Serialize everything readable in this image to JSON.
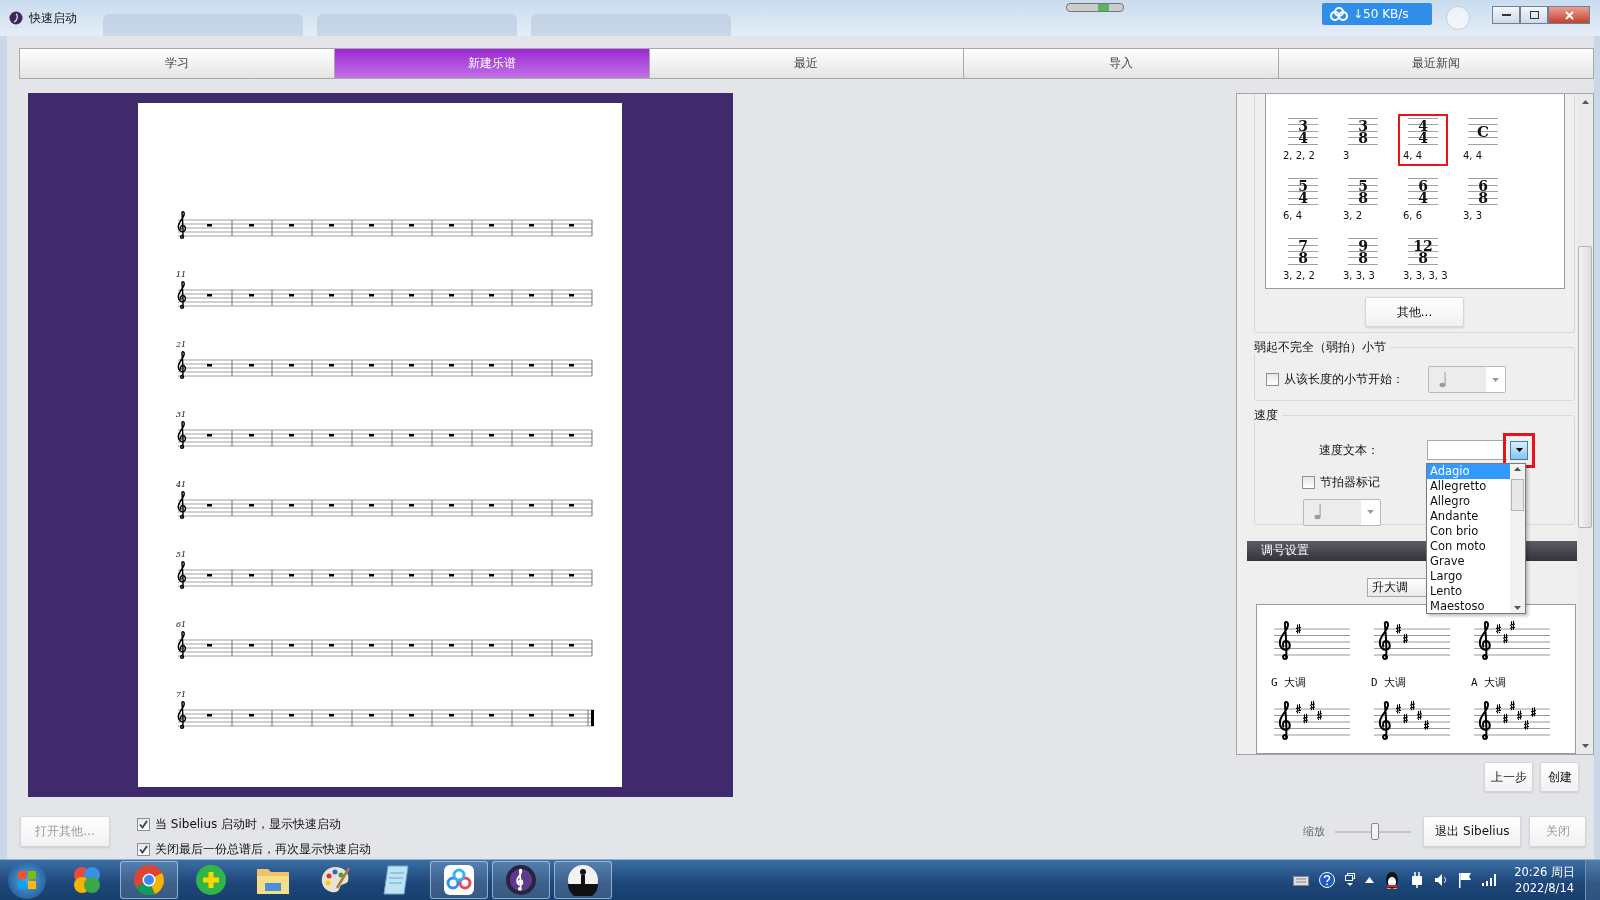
{
  "window": {
    "title": "快速启动"
  },
  "top_bar": {
    "network_speed": "↓50 KB/s"
  },
  "tabs": [
    {
      "label": "学习",
      "selected": false
    },
    {
      "label": "新建乐谱",
      "selected": true
    },
    {
      "label": "最近",
      "selected": false
    },
    {
      "label": "导入",
      "selected": false
    },
    {
      "label": "最近新闻",
      "selected": false
    }
  ],
  "preview": {
    "staves": [
      {
        "final_barline": false
      },
      {
        "measure_number": "11",
        "final_barline": false
      },
      {
        "measure_number": "21",
        "final_barline": false
      },
      {
        "measure_number": "31",
        "final_barline": false
      },
      {
        "measure_number": "41",
        "final_barline": false
      },
      {
        "measure_number": "51",
        "final_barline": false
      },
      {
        "measure_number": "61",
        "final_barline": false
      },
      {
        "measure_number": "71",
        "final_barline": true
      }
    ]
  },
  "time_signatures": {
    "items": [
      {
        "kind": "fraction",
        "numerator": "3",
        "denominator": "4",
        "beams": "2, 2, 2",
        "highlighted": false
      },
      {
        "kind": "fraction",
        "numerator": "3",
        "denominator": "8",
        "beams": "3",
        "highlighted": false
      },
      {
        "kind": "fraction",
        "numerator": "4",
        "denominator": "4",
        "beams": "4, 4",
        "highlighted": true
      },
      {
        "kind": "common",
        "symbol": "C",
        "beams": "4, 4",
        "highlighted": false
      },
      {
        "kind": "fraction",
        "numerator": "5",
        "denominator": "4",
        "beams": "6, 4",
        "highlighted": false
      },
      {
        "kind": "fraction",
        "numerator": "5",
        "denominator": "8",
        "beams": "3, 2",
        "highlighted": false
      },
      {
        "kind": "fraction",
        "numerator": "6",
        "denominator": "4",
        "beams": "6, 6",
        "highlighted": false
      },
      {
        "kind": "fraction",
        "numerator": "6",
        "denominator": "8",
        "beams": "3, 3",
        "highlighted": false
      },
      {
        "kind": "fraction",
        "numerator": "7",
        "denominator": "8",
        "beams": "3, 2, 2",
        "highlighted": false
      },
      {
        "kind": "fraction",
        "numerator": "9",
        "denominator": "8",
        "beams": "3, 3, 3",
        "highlighted": false
      },
      {
        "kind": "fraction",
        "numerator": "12",
        "denominator": "8",
        "beams": "3, 3, 3, 3",
        "highlighted": false
      }
    ],
    "other_button": "其他..."
  },
  "pickup": {
    "title": "弱起不完全（弱拍）小节",
    "checkbox": {
      "label": "从该长度的小节开始：",
      "checked": false
    },
    "note_dropdown": {
      "disabled": true
    }
  },
  "tempo": {
    "title": "速度",
    "text_label": "速度文本：",
    "arrow_highlighted": true,
    "options": [
      {
        "label": "Adagio",
        "selected": true
      },
      {
        "label": "Allegretto",
        "selected": false
      },
      {
        "label": "Allegro",
        "selected": false
      },
      {
        "label": "Andante",
        "selected": false
      },
      {
        "label": "Con brio",
        "selected": false
      },
      {
        "label": "Con moto",
        "selected": false
      },
      {
        "label": "Grave",
        "selected": false
      },
      {
        "label": "Largo",
        "selected": false
      },
      {
        "label": "Lento",
        "selected": false
      },
      {
        "label": "Maestoso",
        "selected": false
      }
    ],
    "metronome": {
      "label": "节拍器标记",
      "checked": false
    },
    "note_dropdown": {
      "disabled": true
    }
  },
  "key_signatures": {
    "title": "调号设置",
    "mode_dropdown": "升大调",
    "items": [
      {
        "kind": "labeled",
        "label": "G 大调"
      },
      {
        "kind": "labeled",
        "label": "D 大调"
      },
      {
        "kind": "labeled",
        "label": "A 大调"
      },
      {
        "kind": "cut"
      },
      {
        "kind": "cut"
      },
      {
        "kind": "cut"
      }
    ]
  },
  "bottom": {
    "open_other": {
      "label": "打开其他...",
      "disabled": true
    },
    "options": [
      {
        "label": "当 Sibelius 启动时，显示快速启动",
        "checked": true
      },
      {
        "label": "关闭最后一份总谱后，再次显示快速启动",
        "checked": true
      }
    ],
    "back": {
      "label": "上一步",
      "disabled": false
    },
    "create": {
      "label": "创建",
      "disabled": false
    },
    "zoom": {
      "label": "缩放",
      "level": 0.53
    },
    "quit": {
      "label": "退出 Sibelius",
      "disabled": false
    },
    "close": {
      "label": "关闭",
      "disabled": true
    }
  },
  "taskbar": {
    "apps": [
      {
        "kind": "circles",
        "running": false
      },
      {
        "kind": "browser",
        "running": true
      },
      {
        "kind": "plus",
        "running": false
      },
      {
        "kind": "folder",
        "running": false
      },
      {
        "kind": "palette",
        "running": false
      },
      {
        "kind": "notepad",
        "running": false
      },
      {
        "kind": "cloud",
        "running": true
      },
      {
        "kind": "music",
        "running": true
      },
      {
        "kind": "figure",
        "running": true
      }
    ],
    "clock": {
      "time": "20:26 周日",
      "date": "2022/8/14"
    }
  }
}
